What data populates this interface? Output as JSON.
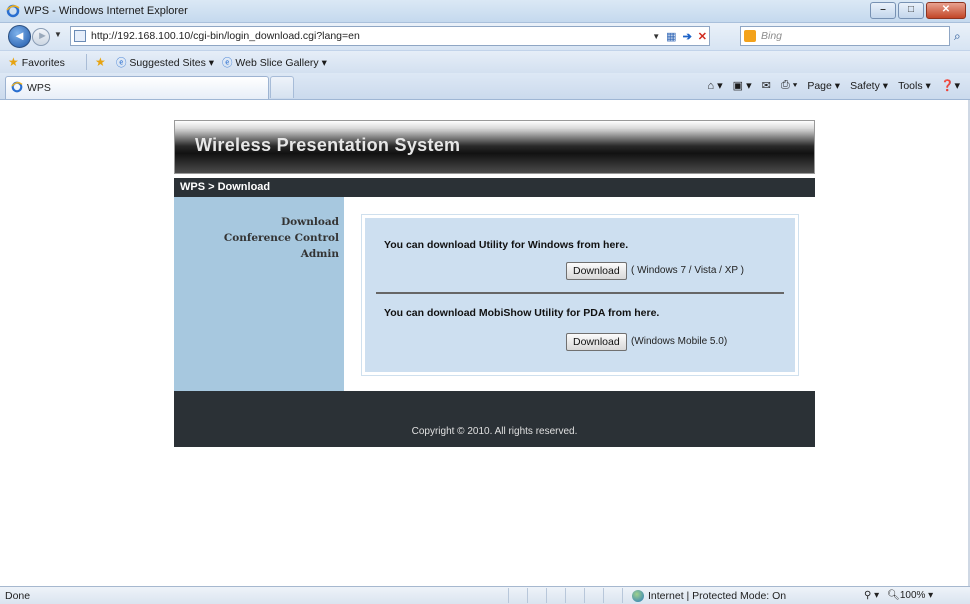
{
  "window": {
    "title": "WPS - Windows Internet Explorer",
    "minimize": "–",
    "maximize": "□",
    "close": "✕"
  },
  "address": {
    "url": "http://192.168.100.10/cgi-bin/login_download.cgi?lang=en"
  },
  "search": {
    "placeholder": "Bing"
  },
  "favorites_bar": {
    "favorites_label": "Favorites",
    "suggested_sites": "Suggested Sites ▾",
    "web_slice_gallery": "Web Slice Gallery ▾"
  },
  "tab": {
    "label": "WPS"
  },
  "command_bar": {
    "page": "Page",
    "safety": "Safety",
    "tools": "Tools"
  },
  "web": {
    "banner_title": "Wireless Presentation System",
    "breadcrumb": "WPS > Download",
    "sidebar": [
      {
        "label": "Download"
      },
      {
        "label": "Conference Control"
      },
      {
        "label": "Admin"
      }
    ],
    "windows_section": {
      "text": "You can download Utility for Windows from here.",
      "button": "Download",
      "note": "( Windows 7 / Vista / XP )"
    },
    "pda_section": {
      "text": "You can download MobiShow Utility for PDA from here.",
      "button": "Download",
      "note": "(Windows Mobile 5.0)"
    },
    "footer": "Copyright © 2010. All rights reserved."
  },
  "status": {
    "text": "Done",
    "zone": "Internet | Protected Mode: On",
    "zoom": "100%"
  },
  "colors": {
    "sidebar": "#a7c8df",
    "panel": "#cddff0",
    "dark_bar": "#2b3136"
  }
}
